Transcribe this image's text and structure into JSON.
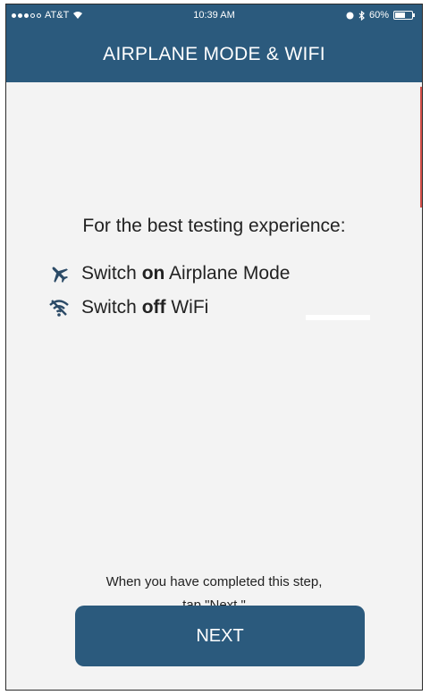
{
  "status_bar": {
    "carrier": "AT&T",
    "time": "10:39 AM",
    "battery": "60%",
    "battery_level": 0.6
  },
  "header": {
    "title": "AIRPLANE MODE & WIFI",
    "color": "#2b5a7d"
  },
  "content": {
    "intro": "For the best testing experience:",
    "items": [
      {
        "icon": "airplane-icon",
        "prefix": "Switch ",
        "emphasis": "on",
        "suffix": " Airplane Mode"
      },
      {
        "icon": "wifi-off-icon",
        "prefix": "Switch ",
        "emphasis": "off",
        "suffix": " WiFi"
      }
    ]
  },
  "footer": {
    "line1": "When you have completed this step,",
    "line2": "tap \"Next.\""
  },
  "next_button": {
    "label": "NEXT"
  }
}
